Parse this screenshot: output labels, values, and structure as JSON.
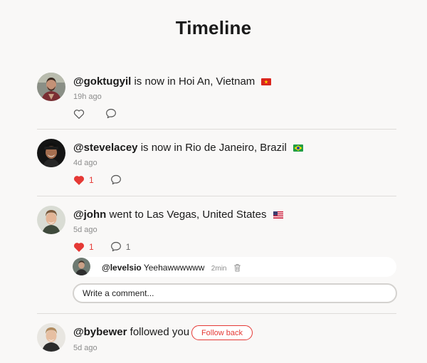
{
  "page": {
    "title": "Timeline"
  },
  "posts": [
    {
      "handle": "@goktugyil",
      "text": "is now in Hoi An, Vietnam",
      "flag": "vietnam-flag",
      "time": "19h ago",
      "likes": "",
      "comments": ""
    },
    {
      "handle": "@stevelacey",
      "text": "is now in Rio de Janeiro, Brazil",
      "flag": "brazil-flag",
      "time": "4d ago",
      "likes": "1",
      "comments": ""
    },
    {
      "handle": "@john",
      "text": "went to Las Vegas, United States",
      "flag": "usa-flag",
      "time": "5d ago",
      "likes": "1",
      "comments": "1",
      "comment": {
        "handle": "@levelsio",
        "text": "Yeehawwwwww",
        "time": "2min"
      },
      "comment_placeholder": "Write a comment..."
    },
    {
      "handle": "@bybewer",
      "text": "followed you",
      "time": "5d ago",
      "button": "Follow back"
    }
  ],
  "colors": {
    "background": "#f9f8f7",
    "accent": "#e53935",
    "divider": "#dedcd9",
    "muted": "#8c8c8c"
  }
}
